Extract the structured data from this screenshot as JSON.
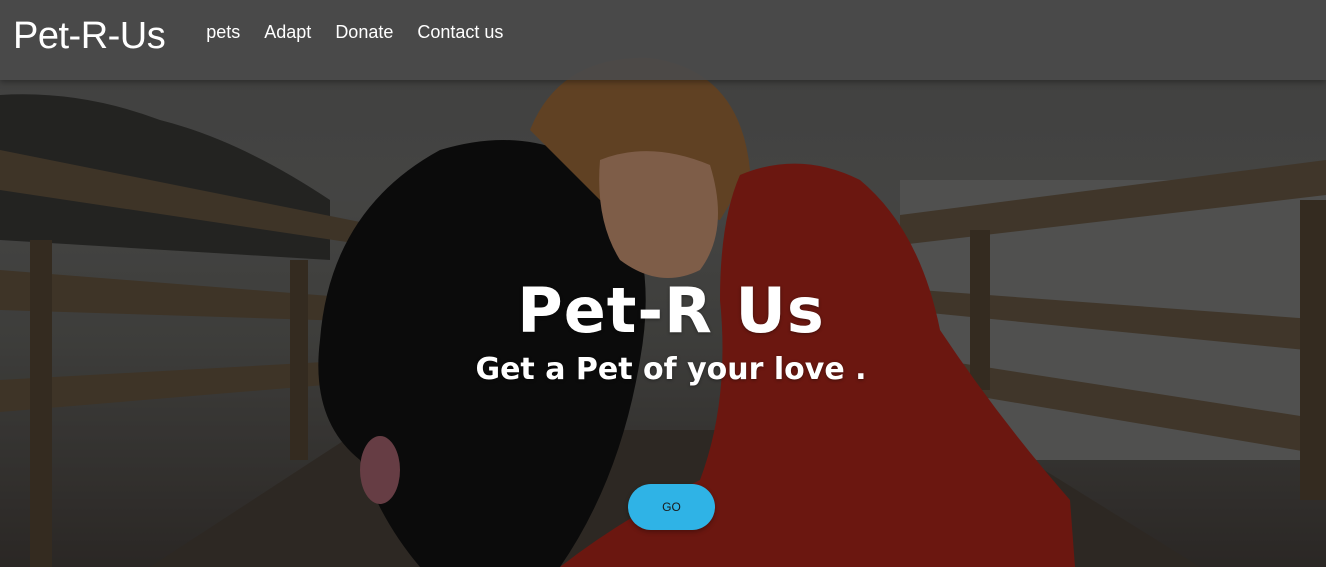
{
  "navbar": {
    "brand": "Pet-R-Us",
    "links": [
      "pets",
      "Adapt",
      "Donate",
      "Contact us"
    ]
  },
  "hero": {
    "title": "Pet-R Us",
    "subtitle": "Get a Pet of your love .",
    "button_label": "GO",
    "image_description_icon": "hero-photo"
  },
  "colors": {
    "navbar_bg": "#4a4a4a",
    "button_bg": "#2fb3e6",
    "text": "#ffffff"
  }
}
